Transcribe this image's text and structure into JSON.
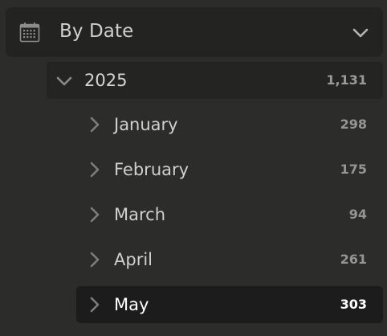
{
  "section": {
    "title": "By Date",
    "icon": "calendar-icon",
    "toggle_icon": "chevron-down-icon"
  },
  "year": {
    "label": "2025",
    "count": "1,131",
    "icon": "chevron-down-icon"
  },
  "months": [
    {
      "label": "January",
      "count": "298",
      "selected": false
    },
    {
      "label": "February",
      "count": "175",
      "selected": false
    },
    {
      "label": "March",
      "count": "94",
      "selected": false
    },
    {
      "label": "April",
      "count": "261",
      "selected": false
    },
    {
      "label": "May",
      "count": "303",
      "selected": true
    }
  ],
  "colors": {
    "background": "#2c2c2b",
    "header_bg": "#232322",
    "selected_bg": "#1c1c1c",
    "text": "#d0d0d0",
    "muted": "#959595"
  }
}
